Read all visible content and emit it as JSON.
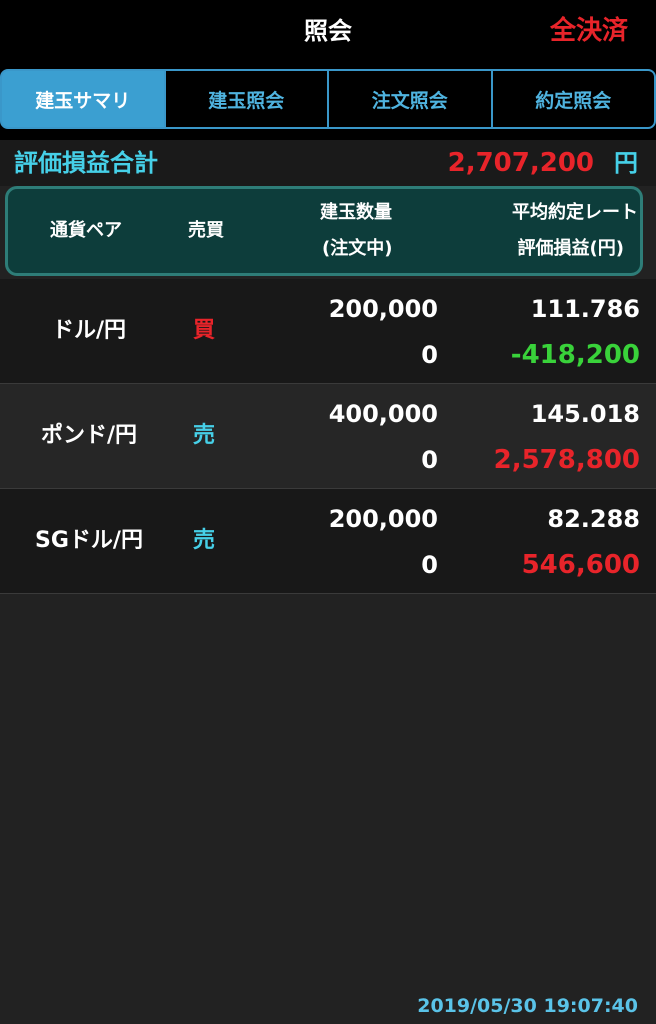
{
  "header": {
    "title": "照会",
    "action_label": "全決済"
  },
  "tabs": [
    {
      "label": "建玉サマリ",
      "active": true
    },
    {
      "label": "建玉照会",
      "active": false
    },
    {
      "label": "注文照会",
      "active": false
    },
    {
      "label": "約定照会",
      "active": false
    }
  ],
  "total": {
    "label": "評価損益合計",
    "value": "2,707,200",
    "unit": "円"
  },
  "columns": {
    "pair": "通貨ペア",
    "side": "売買",
    "qty": "建玉数量",
    "qty_sub": "(注文中)",
    "rate": "平均約定レート",
    "rate_sub": "評価損益(円)"
  },
  "positions": [
    {
      "pair": "ドル/円",
      "side": "買",
      "side_type": "buy",
      "qty": "200,000",
      "pending": "0",
      "rate": "111.786",
      "pl": "-418,200",
      "pl_sign": "neg"
    },
    {
      "pair": "ポンド/円",
      "side": "売",
      "side_type": "sell",
      "qty": "400,000",
      "pending": "0",
      "rate": "145.018",
      "pl": "2,578,800",
      "pl_sign": "pos"
    },
    {
      "pair": "SGドル/円",
      "side": "売",
      "side_type": "sell",
      "qty": "200,000",
      "pending": "0",
      "rate": "82.288",
      "pl": "546,600",
      "pl_sign": "pos"
    }
  ],
  "timestamp": "2019/05/30 19:07:40",
  "colors": {
    "accent": "#3b9fd1",
    "cyan": "#46d0e8",
    "red": "#e8242a",
    "green": "#39d23a",
    "header_bg": "#0d3d3b"
  }
}
